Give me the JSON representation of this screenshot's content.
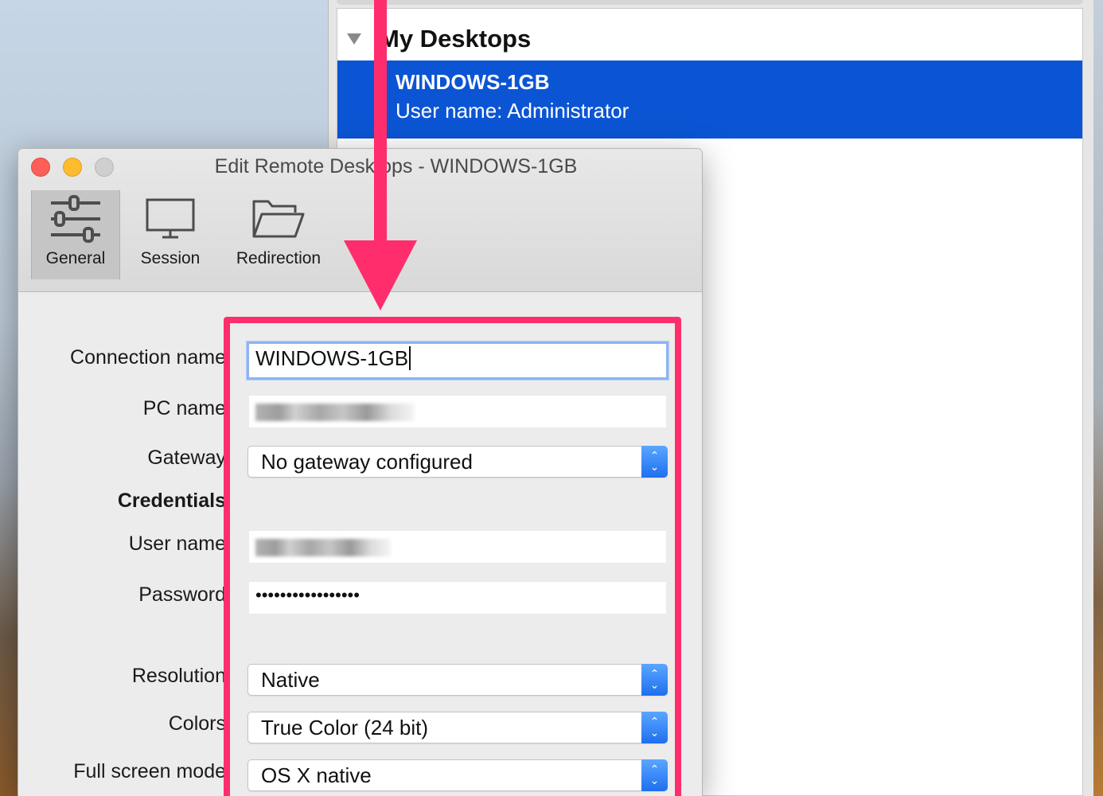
{
  "main_window": {
    "group": {
      "title": "My Desktops",
      "disclosure_icon": "disclosure-triangle-icon"
    },
    "selected_desktop": {
      "name": "WINDOWS-1GB",
      "user_line": "User name: Administrator",
      "highlight_color": "#0b55d4"
    }
  },
  "dialog": {
    "title": "Edit Remote Desktops - WINDOWS-1GB",
    "toolbar": {
      "tabs": [
        {
          "label": "General",
          "icon": "sliders-icon",
          "selected": true
        },
        {
          "label": "Session",
          "icon": "monitor-icon",
          "selected": false
        },
        {
          "label": "Redirection",
          "icon": "folder-icon",
          "selected": false
        }
      ]
    },
    "form": {
      "connection_name": {
        "label": "Connection name",
        "value": "WINDOWS-1GB"
      },
      "pc_name": {
        "label": "PC name"
      },
      "gateway": {
        "label": "Gateway",
        "value": "No gateway configured"
      },
      "credentials": {
        "label": "Credentials"
      },
      "user_name": {
        "label": "User name"
      },
      "password": {
        "label": "Password",
        "value": "•••••••••••••••••"
      },
      "resolution": {
        "label": "Resolution",
        "value": "Native"
      },
      "colors": {
        "label": "Colors",
        "value": "True Color (24 bit)"
      },
      "full_screen_mode": {
        "label": "Full screen mode",
        "value": "OS X native"
      }
    }
  },
  "annotation": {
    "color": "#ff2d6c"
  }
}
